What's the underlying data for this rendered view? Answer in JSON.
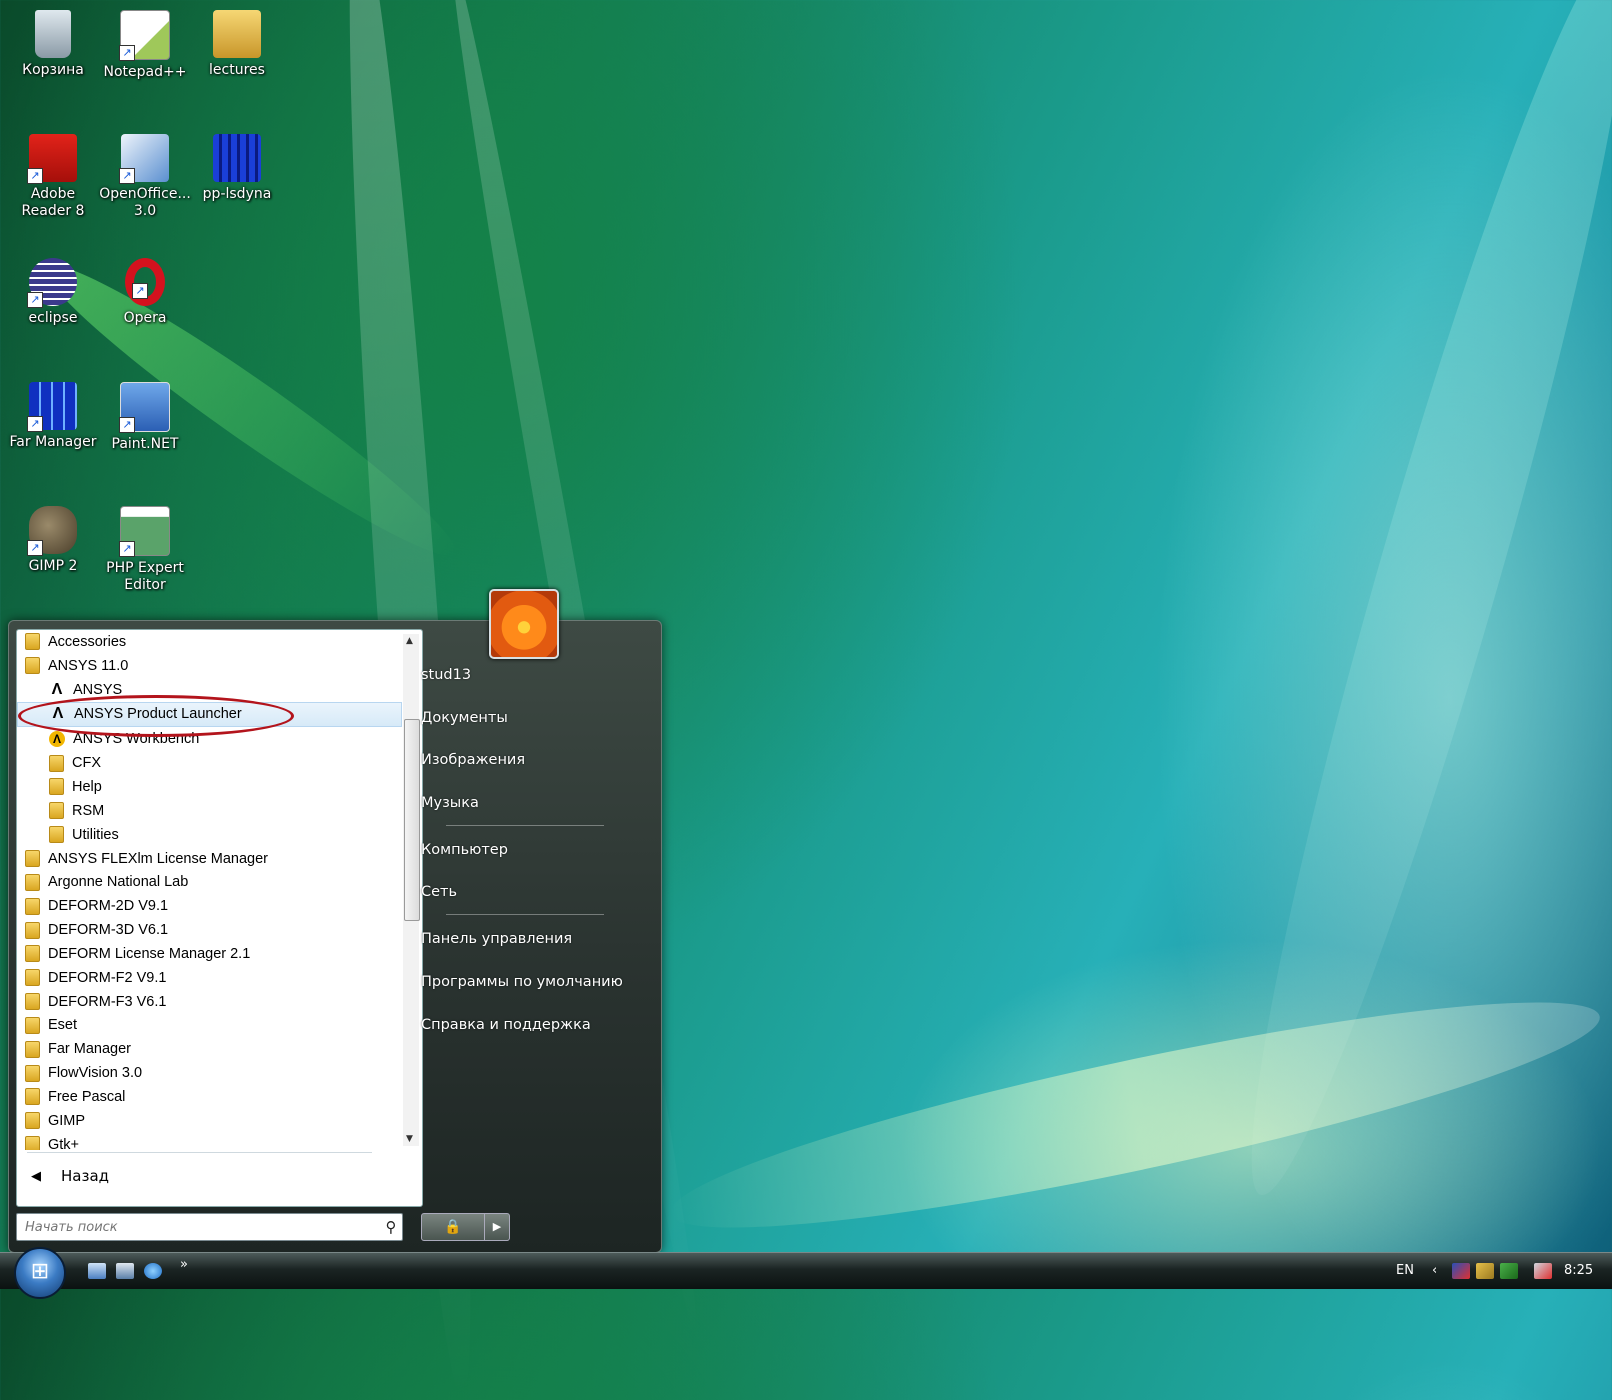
{
  "desktop": {
    "icons": [
      {
        "label": "Корзина",
        "icon": "recycle-bin-icon"
      },
      {
        "label": "Notepad++",
        "icon": "notepad-plus-plus-icon"
      },
      {
        "label": "lectures",
        "icon": "folder-icon"
      },
      {
        "label": "Adobe Reader 8",
        "icon": "adobe-reader-icon"
      },
      {
        "label": "OpenOffice... 3.0",
        "icon": "openoffice-icon"
      },
      {
        "label": "pp-lsdyna",
        "icon": "lsdyna-icon"
      },
      {
        "label": "eclipse",
        "icon": "eclipse-icon"
      },
      {
        "label": "Opera",
        "icon": "opera-icon"
      },
      {
        "label": "Far Manager",
        "icon": "far-manager-icon"
      },
      {
        "label": "Paint.NET",
        "icon": "paint-net-icon"
      },
      {
        "label": "GIMP 2",
        "icon": "gimp-icon"
      },
      {
        "label": "PHP Expert Editor",
        "icon": "php-expert-editor-icon"
      }
    ]
  },
  "start_menu": {
    "programs": [
      {
        "label": "Accessories",
        "icon": "folder-icon",
        "indent": 0
      },
      {
        "label": "ANSYS 11.0",
        "icon": "folder-icon",
        "indent": 0
      },
      {
        "label": "ANSYS",
        "icon": "ansys-icon",
        "indent": 1
      },
      {
        "label": "ANSYS Product Launcher",
        "icon": "ansys-icon",
        "indent": 1,
        "highlighted": true
      },
      {
        "label": "ANSYS Workbench",
        "icon": "ansys-workbench-icon",
        "indent": 1
      },
      {
        "label": "CFX",
        "icon": "folder-icon",
        "indent": 1
      },
      {
        "label": "Help",
        "icon": "folder-icon",
        "indent": 1
      },
      {
        "label": "RSM",
        "icon": "folder-icon",
        "indent": 1
      },
      {
        "label": "Utilities",
        "icon": "folder-icon",
        "indent": 1
      },
      {
        "label": "ANSYS FLEXlm License Manager",
        "icon": "folder-icon",
        "indent": 0
      },
      {
        "label": "Argonne National Lab",
        "icon": "folder-icon",
        "indent": 0
      },
      {
        "label": "DEFORM-2D V9.1",
        "icon": "folder-icon",
        "indent": 0
      },
      {
        "label": "DEFORM-3D V6.1",
        "icon": "folder-icon",
        "indent": 0
      },
      {
        "label": "DEFORM License Manager 2.1",
        "icon": "folder-icon",
        "indent": 0
      },
      {
        "label": "DEFORM-F2 V9.1",
        "icon": "folder-icon",
        "indent": 0
      },
      {
        "label": "DEFORM-F3 V6.1",
        "icon": "folder-icon",
        "indent": 0
      },
      {
        "label": "Eset",
        "icon": "folder-icon",
        "indent": 0
      },
      {
        "label": "Far Manager",
        "icon": "folder-icon",
        "indent": 0
      },
      {
        "label": "FlowVision 3.0",
        "icon": "folder-icon",
        "indent": 0
      },
      {
        "label": "Free Pascal",
        "icon": "folder-icon",
        "indent": 0
      },
      {
        "label": "GIMP",
        "icon": "folder-icon",
        "indent": 0
      },
      {
        "label": "Gtk+",
        "icon": "folder-icon",
        "indent": 0
      }
    ],
    "back_label": "Назад",
    "search_placeholder": "Начать поиск",
    "right_items": [
      {
        "label": "stud13"
      },
      {
        "label": "Документы"
      },
      {
        "label": "Изображения"
      },
      {
        "label": "Музыка"
      },
      {
        "label": "Компьютер"
      },
      {
        "label": "Сеть"
      },
      {
        "label": "Панель управления"
      },
      {
        "label": "Программы по умолчанию"
      },
      {
        "label": "Справка и поддержка"
      }
    ]
  },
  "taskbar": {
    "language": "EN",
    "clock": "8:25",
    "quick_launch_more": "»"
  },
  "colors": {
    "annotation_circle": "#b3141c",
    "start_menu_dark": "#2a3330"
  }
}
